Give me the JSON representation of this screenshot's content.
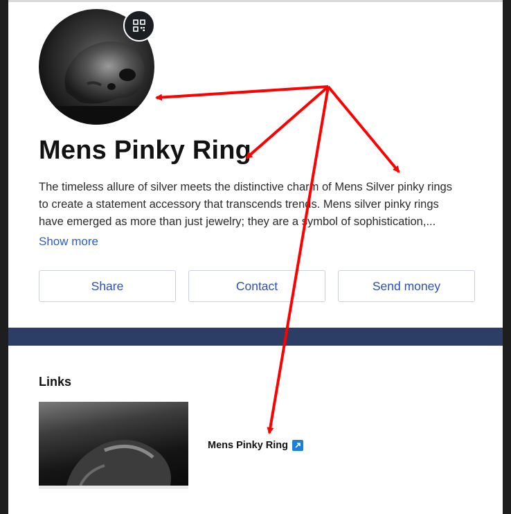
{
  "profile": {
    "title": "Mens Pinky Ring",
    "description": "The timeless allure of silver meets the distinctive charm of Mens Silver pinky rings to create a statement accessory that transcends trends. Mens silver pinky rings have emerged as more than just jewelry; they are a symbol of sophistication,...",
    "show_more_label": "Show more",
    "avatar_icon": "skull-ring-photo",
    "qr_icon": "qr-code-icon"
  },
  "actions": {
    "share_label": "Share",
    "contact_label": "Contact",
    "send_money_label": "Send money"
  },
  "links": {
    "heading": "Links",
    "items": [
      {
        "title": "Mens Pinky Ring",
        "icon": "external-link-icon"
      }
    ]
  },
  "colors": {
    "accent_blue": "#2b5bc4",
    "band": "#2d3e66",
    "annotation_red": "#ff0000"
  }
}
